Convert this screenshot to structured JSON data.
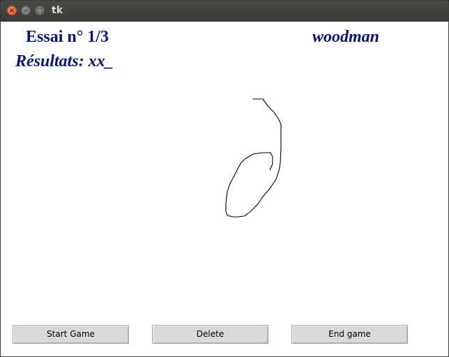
{
  "window": {
    "title": "tk",
    "close_glyph": "×",
    "minimize_glyph": "–",
    "maximize_glyph": "□"
  },
  "header": {
    "essai": "Essai n° 1/3",
    "user": "woodman",
    "results": "Résultats: xx_"
  },
  "colors": {
    "header_text": "#0a1472",
    "titlebar": "#3c3b37",
    "button_bg": "#d9d9d9"
  },
  "buttons": {
    "start": "Start Game",
    "delete": "Delete",
    "end": "End game"
  }
}
